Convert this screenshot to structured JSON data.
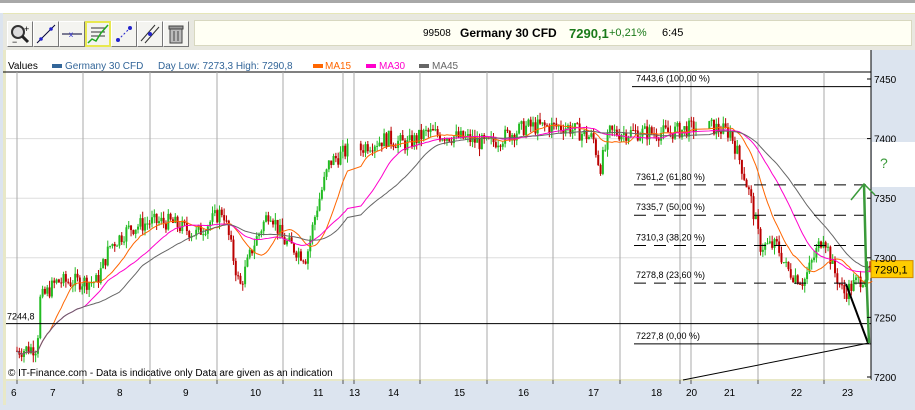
{
  "toolbar": {
    "buttons": [
      {
        "name": "zoom-in-icon"
      },
      {
        "name": "trend-line-icon"
      },
      {
        "name": "horizontal-line-icon"
      },
      {
        "name": "fibonacci-icon",
        "selected": true
      },
      {
        "name": "channel-icon"
      },
      {
        "name": "parallel-lines-icon"
      },
      {
        "name": "trash-icon"
      }
    ]
  },
  "quote": {
    "code": "99508",
    "name": "Germany 30 CFD",
    "price": "7290,1",
    "change": "+0,21%",
    "time": "6:45",
    "price_color": "#1a7a1a"
  },
  "legend": {
    "values_label": "Values",
    "series": "Germany 30 CFD",
    "day_range": "Day Low: 7273,3 High: 7290,8",
    "ma15": "MA15",
    "ma30": "MA30",
    "ma45": "MA45",
    "colors": {
      "series": "#336699",
      "ma15": "#ff6600",
      "ma30": "#ff00cc",
      "ma45": "#666666"
    }
  },
  "chart_data": {
    "type": "candlestick",
    "title": "Germany 30 CFD",
    "y_ticks": [
      "7450",
      "7400",
      "7350",
      "7300",
      "7250",
      "7200"
    ],
    "ylim": [
      7200,
      7450
    ],
    "x_ticks": [
      "6",
      "7",
      "8",
      "9",
      "10",
      "11",
      "13",
      "14",
      "15",
      "16",
      "17",
      "18",
      "20",
      "21",
      "22",
      "23"
    ],
    "path": [
      [
        0.0,
        7222
      ],
      [
        0.3,
        7225
      ],
      [
        0.35,
        7265
      ],
      [
        0.6,
        7280
      ],
      [
        1.2,
        7280
      ],
      [
        1.4,
        7310
      ],
      [
        1.7,
        7325
      ],
      [
        2.0,
        7330
      ],
      [
        2.3,
        7330
      ],
      [
        2.7,
        7320
      ],
      [
        3.1,
        7340
      ],
      [
        3.35,
        7275
      ],
      [
        3.55,
        7310
      ],
      [
        3.8,
        7340
      ],
      [
        4.0,
        7315
      ],
      [
        4.35,
        7300
      ],
      [
        4.5,
        7340
      ],
      [
        4.7,
        7380
      ],
      [
        5.1,
        7395
      ],
      [
        5.4,
        7400
      ],
      [
        5.7,
        7395
      ],
      [
        6.0,
        7405
      ],
      [
        6.6,
        7400
      ],
      [
        6.9,
        7395
      ],
      [
        7.5,
        7410
      ],
      [
        8.1,
        7410
      ],
      [
        8.5,
        7400
      ],
      [
        8.6,
        7375
      ],
      [
        8.75,
        7405
      ],
      [
        9.3,
        7405
      ],
      [
        9.6,
        7405
      ],
      [
        10.1,
        7410
      ],
      [
        10.4,
        7405
      ],
      [
        10.55,
        7380
      ],
      [
        10.7,
        7350
      ],
      [
        10.85,
        7310
      ],
      [
        11.1,
        7310
      ],
      [
        11.25,
        7290
      ],
      [
        11.5,
        7280
      ],
      [
        11.8,
        7320
      ],
      [
        11.95,
        7290
      ],
      [
        12.1,
        7270
      ],
      [
        12.3,
        7280
      ],
      [
        12.55,
        7290
      ]
    ],
    "current_price": "7290,1",
    "fibonacci": [
      {
        "label": "7443,6 (100,00 %)",
        "value": 7443.6
      },
      {
        "label": "7361,2 (61,80 %)",
        "value": 7361.2
      },
      {
        "label": "7335,7 (50,00 %)",
        "value": 7335.7
      },
      {
        "label": "7310,3 (38,20 %)",
        "value": 7310.3
      },
      {
        "label": "7278,8 (23,60 %)",
        "value": 7278.8
      },
      {
        "label": "7227,8 (0,00 %)",
        "value": 7227.8
      }
    ],
    "horizontal_line": {
      "label": "7244,8",
      "value": 7244.8
    },
    "annotation_question": "?",
    "up_color": "#22bb22",
    "down_color": "#bb0000"
  },
  "footer": {
    "copyright": "© IT-Finance.com - Data is indicative only Data are given as an indication"
  }
}
